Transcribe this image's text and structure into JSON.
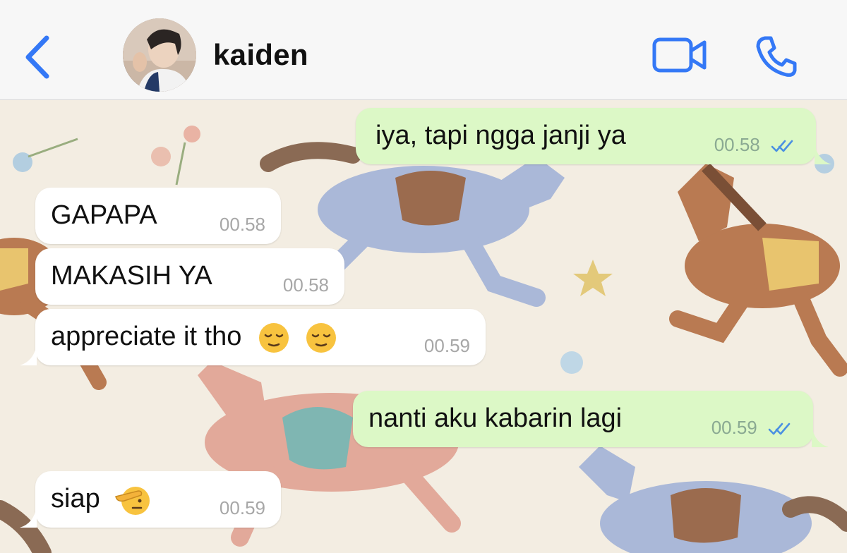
{
  "header": {
    "contact_name": "kaiden",
    "back_icon": "chevron-left-icon",
    "video_icon": "video-camera-icon",
    "call_icon": "phone-icon",
    "accent_color": "#3478f6"
  },
  "messages": [
    {
      "direction": "out",
      "text": "iya, tapi ngga janji ya",
      "time": "00.58",
      "status": "read"
    },
    {
      "direction": "in",
      "text": "GAPAPA",
      "time": "00.58"
    },
    {
      "direction": "in",
      "text": "MAKASIH YA",
      "time": "00.58"
    },
    {
      "direction": "in",
      "text": "appreciate it tho",
      "emojis": [
        "relieved-face-emoji",
        "relieved-face-emoji"
      ],
      "time": "00.59"
    },
    {
      "direction": "out",
      "text": "nanti aku kabarin lagi",
      "time": "00.59",
      "status": "read"
    },
    {
      "direction": "in",
      "text": "siap",
      "emojis": [
        "saluting-face-emoji"
      ],
      "time": "00.59"
    }
  ],
  "colors": {
    "incoming_bubble": "#ffffff",
    "outgoing_bubble": "#dcf8c6",
    "read_ticks": "#4a90e2",
    "wallpaper": "#f3ede2"
  }
}
